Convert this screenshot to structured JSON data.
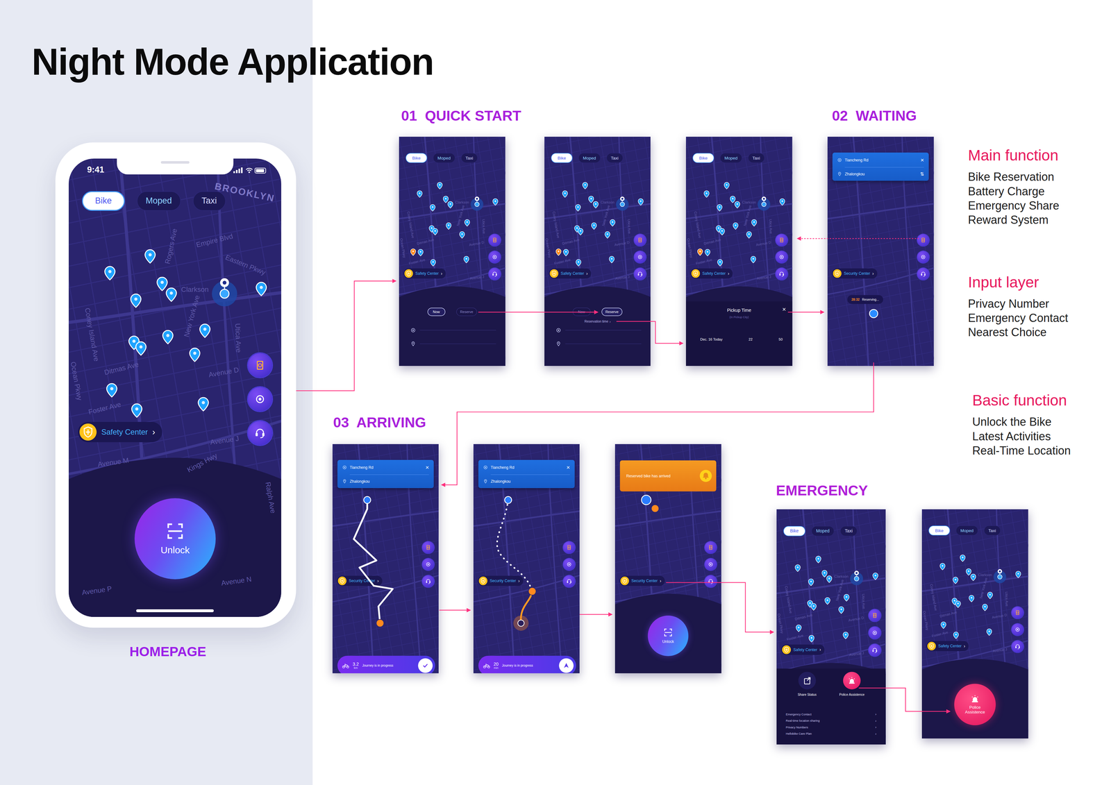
{
  "page": {
    "title": "Night Mode Application"
  },
  "homepage": {
    "label": "HOMEPAGE",
    "time": "9:41",
    "center_label": "Safety Center",
    "chevron": "›",
    "unlock": "Unlock"
  },
  "tabs": [
    {
      "label": "Bike",
      "selected": true
    },
    {
      "label": "Moped",
      "selected": false
    },
    {
      "label": "Taxi",
      "selected": false
    }
  ],
  "map_labels": [
    "BROOKLYN",
    "Eastern Pkwy",
    "Empire Blvd",
    "Rogers Ave",
    "New York Ave",
    "Utica Ave",
    "Ditmas Ave",
    "Foster Ave",
    "Avenue D",
    "Clarkson",
    "Avenue J",
    "Avenue M",
    "Kings Hwy",
    "Avenue N",
    "Avenue P",
    "Ocean Pkwy",
    "Coney Island Ave",
    "Ralph Ave"
  ],
  "sections": [
    "01  QUICK START",
    "02  WAITING",
    "03  ARRIVING",
    "EMERGENCY"
  ],
  "screens": [
    {
      "kind": "quick-start",
      "center_label": "Safety Center",
      "chevron": "›",
      "options": [
        {
          "label": "Now",
          "selected": true
        },
        {
          "label": "Reserve",
          "selected": false
        }
      ]
    },
    {
      "kind": "reserve-time",
      "center_label": "Safety Center",
      "chevron": "›",
      "options": [
        {
          "label": "Now",
          "selected": false
        },
        {
          "label": "Reserve",
          "selected": true
        }
      ],
      "link": "Reservation time",
      "link_chevron": "›"
    },
    {
      "kind": "pickup-time",
      "center_label": "Safety Center",
      "chevron": "›",
      "sheet_title": "Pickup Time",
      "sheet_subtitle": "(In Pickup City)",
      "close": "×",
      "picker": [
        "Dec. 16 Today",
        "22",
        "50"
      ]
    },
    {
      "kind": "waiting",
      "center_label": "Security Center",
      "chevron": "›",
      "from": "Tiancheng Rd",
      "to": "Zhalongkou",
      "close": "×",
      "swap": "⇅",
      "timer": "28:32",
      "status": "Reserving..."
    },
    {
      "kind": "route",
      "center_label": "Security Center",
      "chevron": "›",
      "from": "Tiancheng Rd",
      "to": "Zhalongkou",
      "close": "×",
      "distance": "3.2",
      "unit": "km",
      "progress": "Journey is in progress"
    },
    {
      "kind": "route-progress",
      "center_label": "Security Center",
      "chevron": "›",
      "from": "Tiancheng Rd",
      "to": "Zhalongkou",
      "close": "×",
      "distance": "20",
      "unit": "min",
      "progress": "Journey is in progress"
    },
    {
      "kind": "arrived",
      "center_label": "Security Center",
      "chevron": "›",
      "notice": "Reserved bike has arrived",
      "unlock": "Unlock"
    },
    {
      "kind": "emergency-sheet",
      "center_label": "Safety Center",
      "chevron": "›",
      "actions": [
        "Share Status",
        "Police Assistence"
      ],
      "list": [
        "Emergency Contact",
        "Real-time location sharing",
        "Privacy Numbers",
        "Hellobike Care Plan"
      ],
      "list_chevron": "›"
    },
    {
      "kind": "police",
      "center_label": "Safety Center",
      "chevron": "›",
      "button": "Police Assistence"
    }
  ],
  "notes": [
    {
      "heading": "Main function",
      "items": [
        "Bike Reservation",
        "Battery Charge",
        "Emergency Share",
        "Reward System"
      ]
    },
    {
      "heading": "Input layer",
      "items": [
        "Privacy Number",
        "Emergency Contact",
        "Nearest Choice"
      ]
    },
    {
      "heading": "Basic function",
      "items": [
        "Unlock the Bike",
        "Latest Activities",
        "Real-Time Location"
      ]
    }
  ]
}
